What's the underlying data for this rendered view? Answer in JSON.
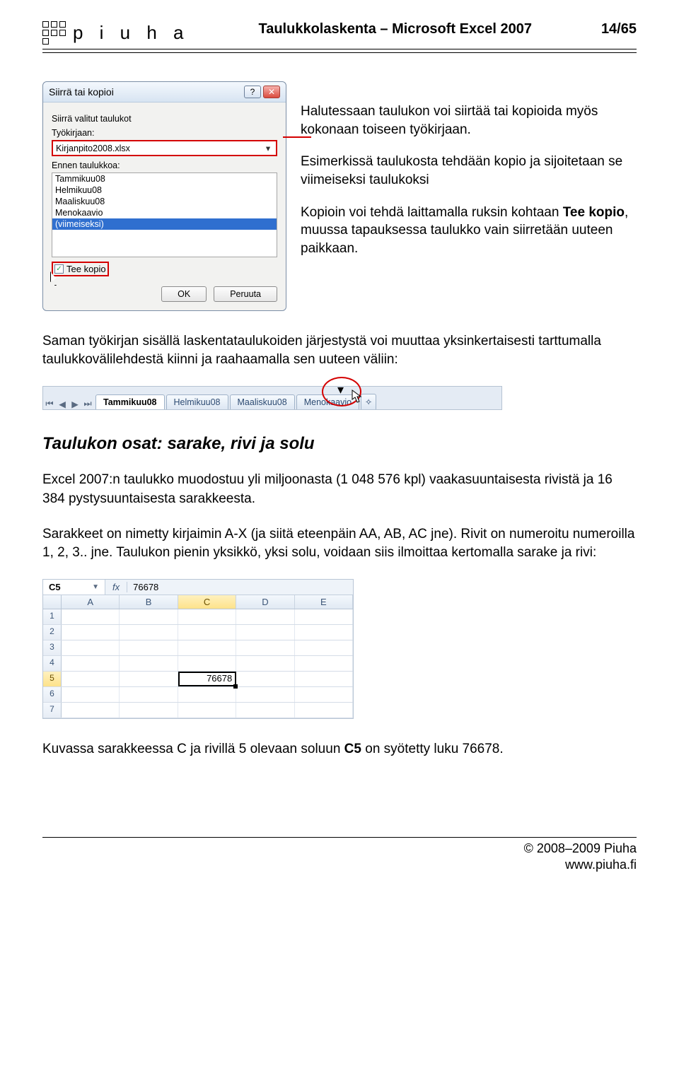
{
  "header": {
    "brand": "p i u h a",
    "title": "Taulukkolaskenta – Microsoft Excel 2007",
    "page": "14/65"
  },
  "dialog": {
    "title": "Siirrä tai kopioi",
    "label_move": "Siirrä valitut taulukot",
    "label_workbook": "Työkirjaan:",
    "combo_value": "Kirjanpito2008.xlsx",
    "label_before": "Ennen taulukkoa:",
    "list": [
      "Tammikuu08",
      "Helmikuu08",
      "Maaliskuu08",
      "Menokaavio",
      "(viimeiseksi)"
    ],
    "checkbox": "Tee kopio",
    "ok": "OK",
    "cancel": "Peruuta"
  },
  "notes": {
    "p1": "Halutessaan taulukon voi siirtää tai kopioida myös kokonaan toiseen työkirjaan.",
    "p2": "Esimerkissä taulukosta tehdään kopio ja sijoitetaan se viimeiseksi taulukoksi",
    "p3a": "Kopioin voi tehdä laittamalla ruksin kohtaan ",
    "p3b": "Tee kopio",
    "p3c": ", muussa tapauksessa taulukko vain siirretään uuteen paikkaan."
  },
  "para_reorder": "Saman työkirjan sisällä laskentataulukoiden järjestystä voi muuttaa yksinkertaisesti tarttumalla taulukkovälilehdestä kiinni ja raahaamalla sen uuteen väliin:",
  "tabs": [
    "Tammikuu08",
    "Helmikuu08",
    "Maaliskuu08",
    "Menokaavio"
  ],
  "section_title": "Taulukon osat: sarake, rivi ja solu",
  "para_size": "Excel 2007:n taulukko muodostuu yli miljoonasta (1 048 576 kpl) vaakasuuntaisesta rivistä ja 16 384 pystysuuntaisesta sarakkeesta.",
  "para_naming": "Sarakkeet on nimetty kirjaimin A-X (ja siitä eteenpäin AA, AB, AC jne). Rivit on numeroitu numeroilla 1, 2, 3.. jne. Taulukon pienin yksikkö, yksi solu, voidaan siis ilmoittaa kertomalla sarake ja rivi:",
  "grid": {
    "namebox": "C5",
    "fx": "fx",
    "formula": "76678",
    "cols": [
      "A",
      "B",
      "C",
      "D",
      "E"
    ],
    "rows": [
      "1",
      "2",
      "3",
      "4",
      "5",
      "6",
      "7"
    ],
    "active_row": 5,
    "active_col": 2,
    "active_value": "76678"
  },
  "para_caption_a": "Kuvassa sarakkeessa C ja rivillä 5 olevaan soluun ",
  "para_caption_b": "C5",
  "para_caption_c": " on syötetty luku 76678.",
  "footer": {
    "copyright": "© 2008–2009 Piuha",
    "url": "www.piuha.fi"
  }
}
